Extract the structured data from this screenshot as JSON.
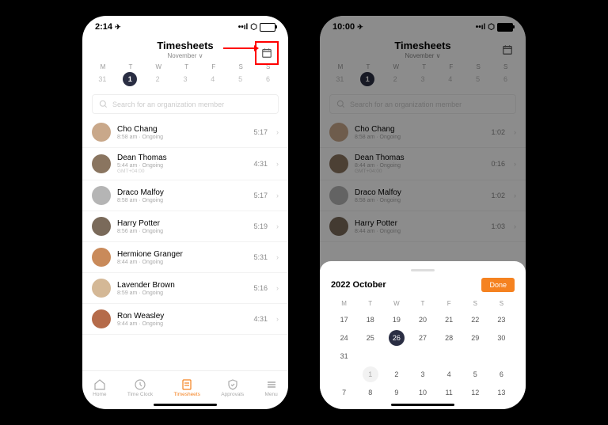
{
  "left": {
    "time": "2:14",
    "title": "Timesheets",
    "subtitle": "November ∨",
    "days": [
      "M",
      "T",
      "W",
      "T",
      "F",
      "S",
      "S"
    ],
    "dates": [
      "31",
      "1",
      "2",
      "3",
      "4",
      "5",
      "6"
    ],
    "selIdx": 1,
    "search": "Search for an organization member",
    "members": [
      {
        "name": "Cho Chang",
        "meta": "8:58 am · Ongoing",
        "time": "5:17",
        "avatar": "#c9a88a"
      },
      {
        "name": "Dean Thomas",
        "meta": "5:44 am · Ongoing",
        "meta2": "GMT+04:00",
        "time": "4:31",
        "avatar": "#8a7560"
      },
      {
        "name": "Draco Malfoy",
        "meta": "8:58 am · Ongoing",
        "time": "5:17",
        "avatar": "#b5b5b5"
      },
      {
        "name": "Harry Potter",
        "meta": "8:56 am · Ongoing",
        "time": "5:19",
        "avatar": "#7a6a5a"
      },
      {
        "name": "Hermione Granger",
        "meta": "8:44 am · Ongoing",
        "time": "5:31",
        "avatar": "#c98a5a"
      },
      {
        "name": "Lavender Brown",
        "meta": "8:59 am · Ongoing",
        "time": "5:16",
        "avatar": "#d4b896"
      },
      {
        "name": "Ron Weasley",
        "meta": "9:44 am · Ongoing",
        "time": "4:31",
        "avatar": "#b56b4a"
      }
    ],
    "tabs": [
      "Home",
      "Time Clock",
      "Timesheets",
      "Approvals",
      "Menu"
    ]
  },
  "right": {
    "time": "10:00",
    "title": "Timesheets",
    "subtitle": "November ∨",
    "days": [
      "M",
      "T",
      "W",
      "T",
      "F",
      "S",
      "S"
    ],
    "dates": [
      "31",
      "1",
      "2",
      "3",
      "4",
      "5",
      "6"
    ],
    "selIdx": 1,
    "search": "Search for an organization member",
    "members": [
      {
        "name": "Cho Chang",
        "meta": "8:58 am · Ongoing",
        "time": "1:02",
        "avatar": "#c9a88a"
      },
      {
        "name": "Dean Thomas",
        "meta": "8:44 am · Ongoing",
        "meta2": "GMT+04:00",
        "time": "0:16",
        "avatar": "#8a7560"
      },
      {
        "name": "Draco Malfoy",
        "meta": "8:58 am · Ongoing",
        "time": "1:02",
        "avatar": "#b5b5b5"
      },
      {
        "name": "Harry Potter",
        "meta": "8:44 am · Ongoing",
        "time": "1:03",
        "avatar": "#7a6a5a"
      }
    ],
    "sheetTitle": "2022 October",
    "done": "Done",
    "calDays": [
      "M",
      "T",
      "W",
      "T",
      "F",
      "S",
      "S"
    ],
    "calRows": [
      [
        "17",
        "18",
        "19",
        "20",
        "21",
        "22",
        "23"
      ],
      [
        "24",
        "25",
        "26",
        "27",
        "28",
        "29",
        "30"
      ],
      [
        "31",
        "",
        "",
        "",
        "",
        "",
        ""
      ],
      [
        "",
        "1",
        "2",
        "3",
        "4",
        "5",
        "6"
      ],
      [
        "7",
        "8",
        "9",
        "10",
        "11",
        "12",
        "13"
      ]
    ],
    "selRow": 1,
    "selCol": 2,
    "fadeRow": 3,
    "fadeCol": 1
  }
}
